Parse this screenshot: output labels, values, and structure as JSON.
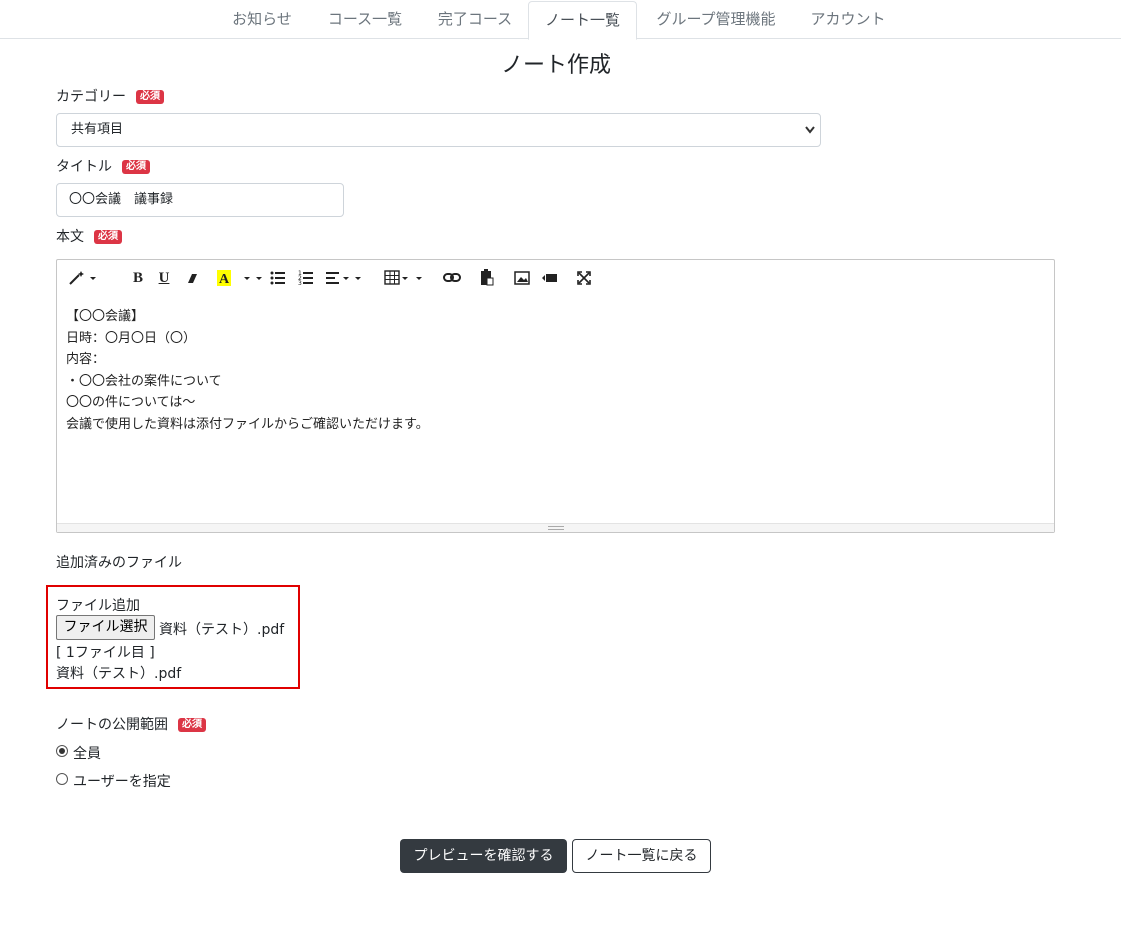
{
  "nav": {
    "tabs": [
      {
        "label": "お知らせ"
      },
      {
        "label": "コース一覧"
      },
      {
        "label": "完了コース"
      },
      {
        "label": "ノート一覧"
      },
      {
        "label": "グループ管理機能"
      },
      {
        "label": "アカウント"
      }
    ]
  },
  "page": {
    "title": "ノート作成"
  },
  "required_badge": "必須",
  "category": {
    "label": "カテゴリー",
    "selected": "共有項目"
  },
  "title_field": {
    "label": "タイトル",
    "value": "〇〇会議　議事録"
  },
  "body": {
    "label": "本文",
    "toolbar": {
      "icons": [
        "magic-icon",
        "bold-icon",
        "underline-icon",
        "eraser-icon",
        "font-color-icon",
        "bullet-list-icon",
        "ordered-list-icon",
        "align-icon",
        "table-icon",
        "link-icon",
        "paste-icon",
        "image-icon",
        "video-icon",
        "fullscreen-icon"
      ],
      "font_color": "#ffff00"
    },
    "lines": [
      "【〇〇会議】",
      "日時：〇月〇日（〇）",
      "内容：",
      "・〇〇会社の案件について",
      "〇〇の件については～",
      "会議で使用した資料は添付ファイルからご確認いただけます。"
    ]
  },
  "attached": {
    "label": "追加済みのファイル"
  },
  "file_add": {
    "label": "ファイル追加",
    "button": "ファイル選択",
    "chosen": "資料（テスト）.pdf",
    "index_label": "[ 1ファイル目 ]",
    "file_name": "資料（テスト）.pdf"
  },
  "visibility": {
    "label": "ノートの公開範囲",
    "options": [
      {
        "label": "全員",
        "checked": true
      },
      {
        "label": "ユーザーを指定",
        "checked": false
      }
    ]
  },
  "actions": {
    "preview": "プレビューを確認する",
    "back": "ノート一覧に戻る"
  }
}
